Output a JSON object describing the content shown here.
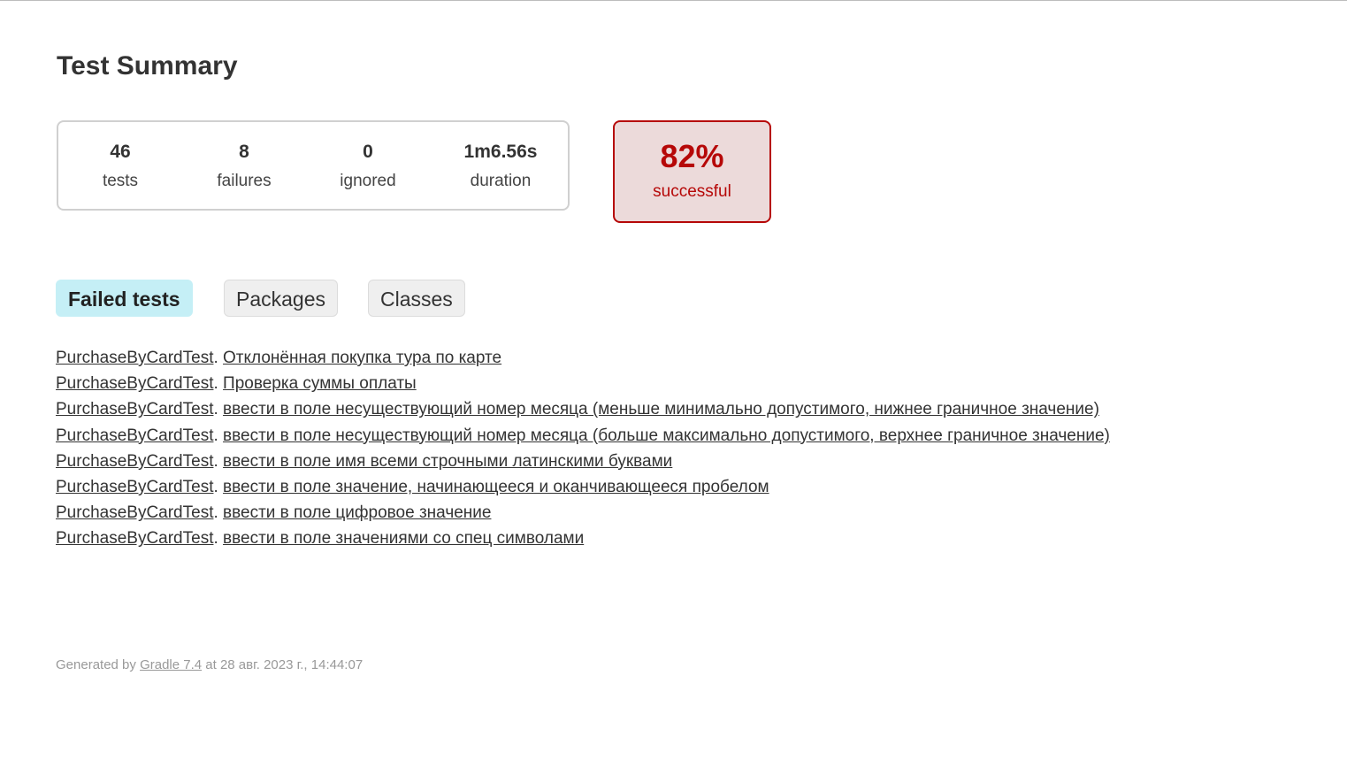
{
  "title": "Test Summary",
  "summary": {
    "tests": {
      "value": "46",
      "label": "tests"
    },
    "failures": {
      "value": "8",
      "label": "failures"
    },
    "ignored": {
      "value": "0",
      "label": "ignored"
    },
    "duration": {
      "value": "1m6.56s",
      "label": "duration"
    }
  },
  "success": {
    "percent": "82%",
    "label": "successful",
    "color": "#b60808",
    "background": "#ecdada"
  },
  "tabs": [
    {
      "label": "Failed tests",
      "active": true
    },
    {
      "label": "Packages",
      "active": false
    },
    {
      "label": "Classes",
      "active": false
    }
  ],
  "failed_tests": [
    {
      "class": "PurchaseByCardTest",
      "separator": ".",
      "test": "Отклонённая покупка тура по карте"
    },
    {
      "class": "PurchaseByCardTest",
      "separator": ".",
      "test": "Проверка суммы оплаты"
    },
    {
      "class": "PurchaseByCardTest",
      "separator": ".",
      "test": "ввести в поле несуществующий номер месяца (меньше минимально допустимого, нижнее граничное значение)"
    },
    {
      "class": "PurchaseByCardTest",
      "separator": ".",
      "test": "ввести в поле несуществующий номер месяца (больше максимально допустимого, верхнее граничное значение)"
    },
    {
      "class": "PurchaseByCardTest",
      "separator": ".",
      "test": "ввести в поле имя всеми строчными латинскими буквами"
    },
    {
      "class": "PurchaseByCardTest",
      "separator": ".",
      "test": "ввести в поле значение, начинающееся и оканчивающееся пробелом"
    },
    {
      "class": "PurchaseByCardTest",
      "separator": ".",
      "test": "ввести в поле цифровое значение"
    },
    {
      "class": "PurchaseByCardTest",
      "separator": ".",
      "test": "ввести в поле значениями со спец символами"
    }
  ],
  "footer": {
    "prefix": "Generated by ",
    "link": "Gradle 7.4",
    "suffix": " at 28 авг. 2023 г., 14:44:07"
  }
}
